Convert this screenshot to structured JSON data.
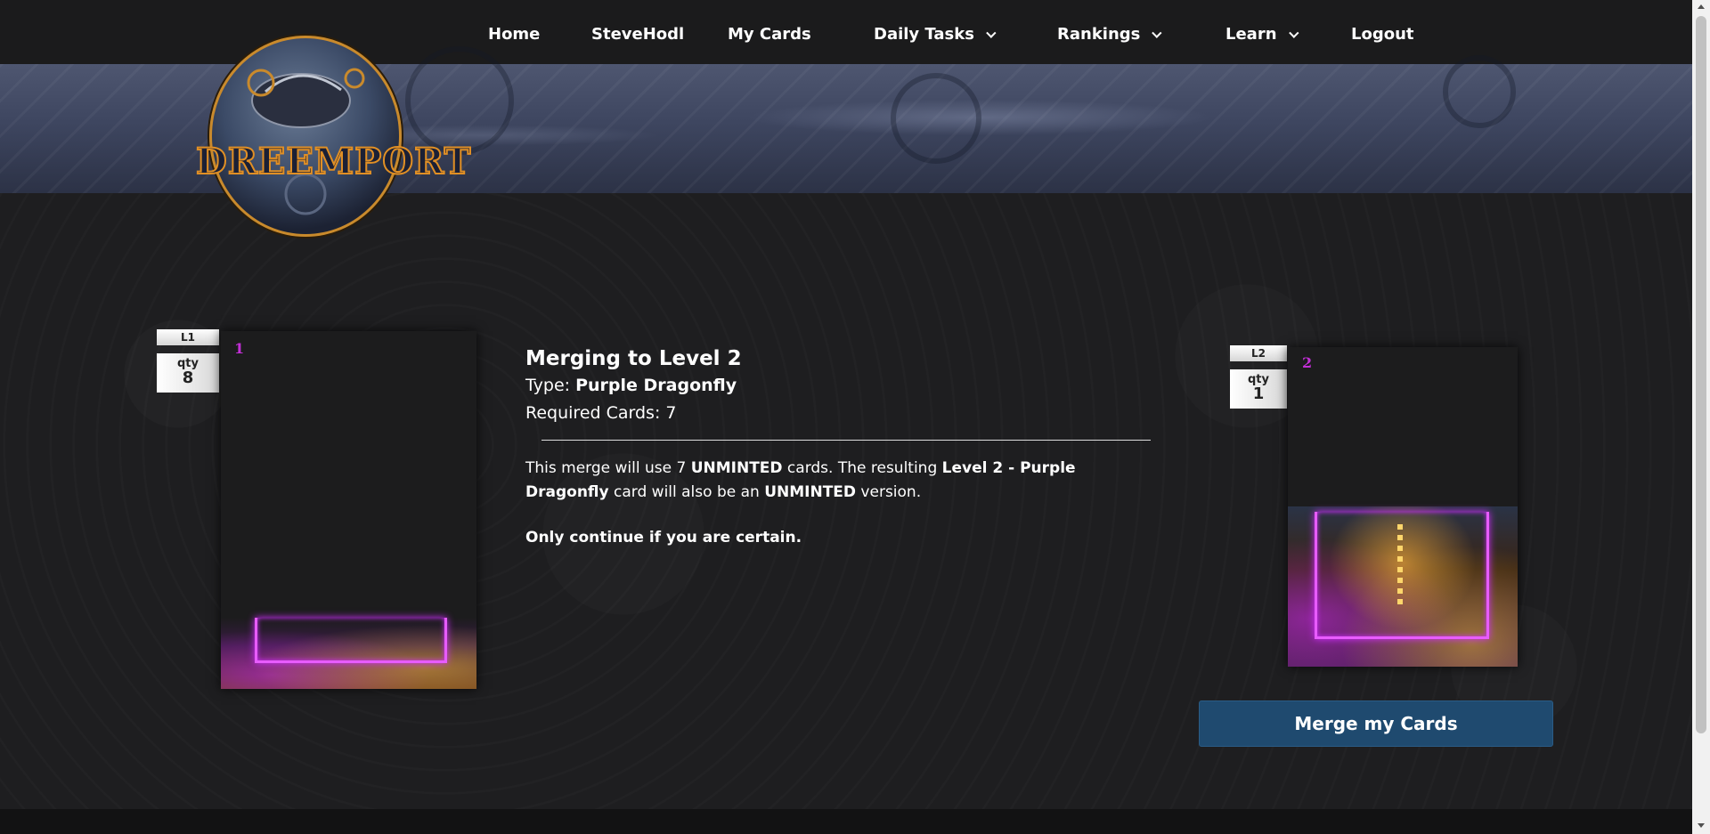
{
  "nav": {
    "home": "Home",
    "user": "SteveHodl",
    "my_cards": "My Cards",
    "daily_tasks": "Daily Tasks",
    "rankings": "Rankings",
    "learn": "Learn",
    "logout": "Logout"
  },
  "logo": {
    "text": "DREEMPORT"
  },
  "source_card": {
    "level": "L1",
    "qty_label": "qty",
    "qty": "8",
    "number": "1"
  },
  "result_card": {
    "level": "L2",
    "qty_label": "qty",
    "qty": "1",
    "number": "2"
  },
  "merge": {
    "title": "Merging to Level 2",
    "type_label": "Type: ",
    "type_value": "Purple Dragonfly",
    "required_label": "Required Cards: ",
    "required_value": "7",
    "desc_1": "This merge will use 7 ",
    "desc_unminted_1": "UNMINTED",
    "desc_2": " cards. The resulting ",
    "desc_result": "Level 2 - Purple Dragonfly",
    "desc_3": " card will also be an ",
    "desc_unminted_2": "UNMINTED",
    "desc_4": " version.",
    "warning": "Only continue if you are certain.",
    "button": "Merge my Cards"
  },
  "colors": {
    "accent_button": "#1f4a6f",
    "card_number": "#c22fd6",
    "neon": "#e85cff"
  }
}
